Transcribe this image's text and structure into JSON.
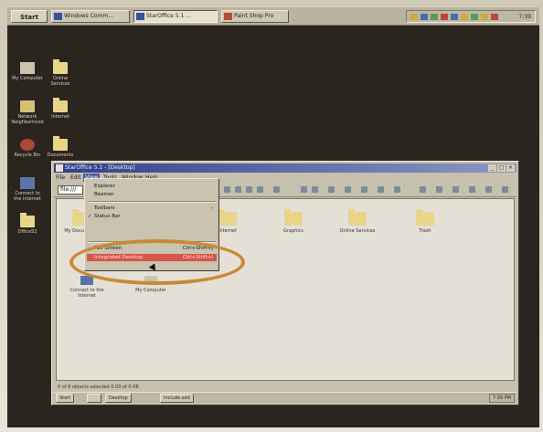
{
  "taskbar": {
    "start_label": "Start",
    "tasks": [
      "Windows Comm...",
      "StarOffice 5.1 ...",
      "Paint Shop Pro"
    ],
    "clock": "7:39"
  },
  "desktop": {
    "icons": [
      "My Computer",
      "Network Neighborhood",
      "Recycle Bin",
      "Connect to the Internet",
      "Online Services",
      "Internet",
      "Documents",
      "Office52"
    ]
  },
  "window": {
    "title": "StarOffice 5.1 - [Desktop]",
    "menu": [
      "File",
      "Edit",
      "View",
      "Tools",
      "Window",
      "Help"
    ],
    "url_value": "file:///",
    "folders": [
      "My Documents",
      "Internet",
      "Graphics",
      "Online Services",
      "Trash",
      "Connect to the Internet",
      "My Computer"
    ],
    "status": "0 of 8 objects selected 0.00 of 0 KB",
    "taskbar_items": [
      "Start",
      "Desktop",
      "Include.sdd"
    ],
    "taskbar_time": "7:39 PM"
  },
  "view_menu": {
    "items": [
      {
        "label": "Explorer",
        "shortcut": ""
      },
      {
        "label": "Beamer",
        "shortcut": ""
      },
      {
        "label": "Toolbars",
        "shortcut": ""
      },
      {
        "label": "Status Bar",
        "shortcut": ""
      },
      {
        "label": "Full Screen",
        "shortcut": "Ctrl+Shift+J"
      },
      {
        "label": "Integrated Desktop",
        "shortcut": "Ctrl+Shift+I"
      }
    ]
  },
  "colors": {
    "highlight": "#d9544a",
    "oval": "#c98a35",
    "titlebar": "#2f3f8a"
  }
}
